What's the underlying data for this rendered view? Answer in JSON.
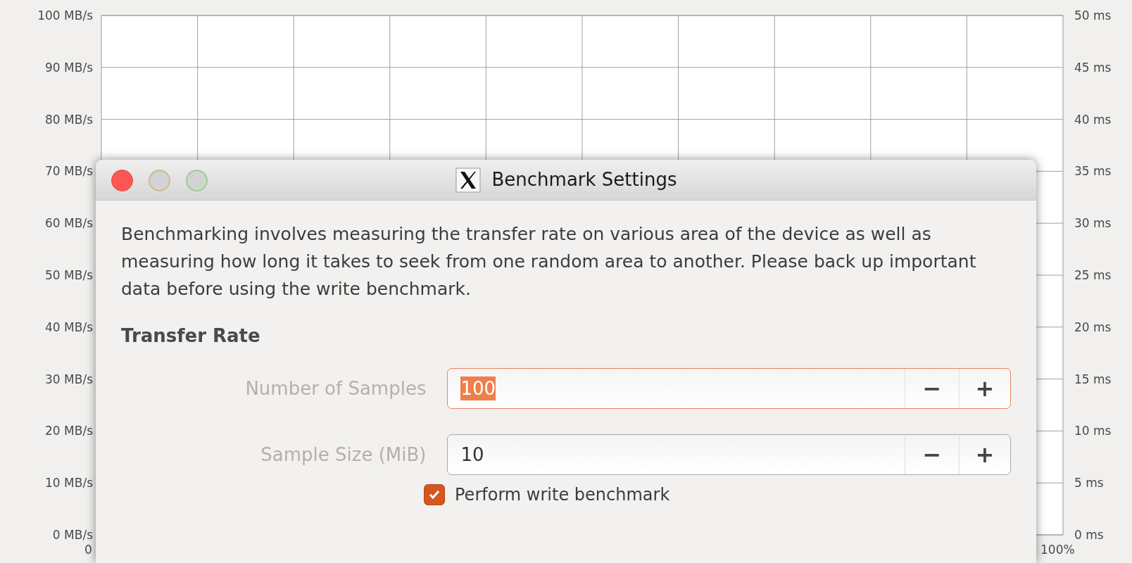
{
  "chart": {
    "chart_data": {
      "type": "line",
      "grid": true,
      "xlim": [
        0,
        100
      ],
      "ylim": [
        0,
        100
      ],
      "y2lim": [
        0,
        50
      ],
      "xticks": [
        {
          "value": 0,
          "label": "0"
        },
        {
          "value": 100,
          "label": "100%"
        }
      ],
      "yticks": [
        {
          "value": 100,
          "label": "100 MB/s"
        },
        {
          "value": 90,
          "label": "90 MB/s"
        },
        {
          "value": 80,
          "label": "80 MB/s"
        },
        {
          "value": 70,
          "label": "70 MB/s"
        },
        {
          "value": 60,
          "label": "60 MB/s"
        },
        {
          "value": 50,
          "label": "50 MB/s"
        },
        {
          "value": 40,
          "label": "40 MB/s"
        },
        {
          "value": 30,
          "label": "30 MB/s"
        },
        {
          "value": 20,
          "label": "20 MB/s"
        },
        {
          "value": 10,
          "label": "10 MB/s"
        },
        {
          "value": 0,
          "label": "0 MB/s"
        }
      ],
      "y2ticks": [
        {
          "value": 50,
          "label": "50 ms"
        },
        {
          "value": 45,
          "label": "45 ms"
        },
        {
          "value": 40,
          "label": "40 ms"
        },
        {
          "value": 35,
          "label": "35 ms"
        },
        {
          "value": 30,
          "label": "30 ms"
        },
        {
          "value": 25,
          "label": "25 ms"
        },
        {
          "value": 20,
          "label": "20 ms"
        },
        {
          "value": 15,
          "label": "15 ms"
        },
        {
          "value": 10,
          "label": "10 ms"
        },
        {
          "value": 5,
          "label": "5 ms"
        },
        {
          "value": 0,
          "label": "0 ms"
        }
      ]
    }
  },
  "dialog": {
    "title": "Benchmark Settings",
    "description": "Benchmarking involves measuring the transfer rate on various area of the device as well as measuring how long it takes to seek from one random area to another. Please back up important data before using the write benchmark.",
    "section": "Transfer Rate",
    "fields": [
      {
        "label": "Number of Samples",
        "value": "100",
        "focused": true,
        "decrement": "−",
        "increment": "+"
      },
      {
        "label": "Sample Size (MiB)",
        "value": "10",
        "focused": false,
        "decrement": "−",
        "increment": "+"
      }
    ],
    "checkbox": {
      "label": "Perform write benchmark",
      "checked": true
    }
  }
}
